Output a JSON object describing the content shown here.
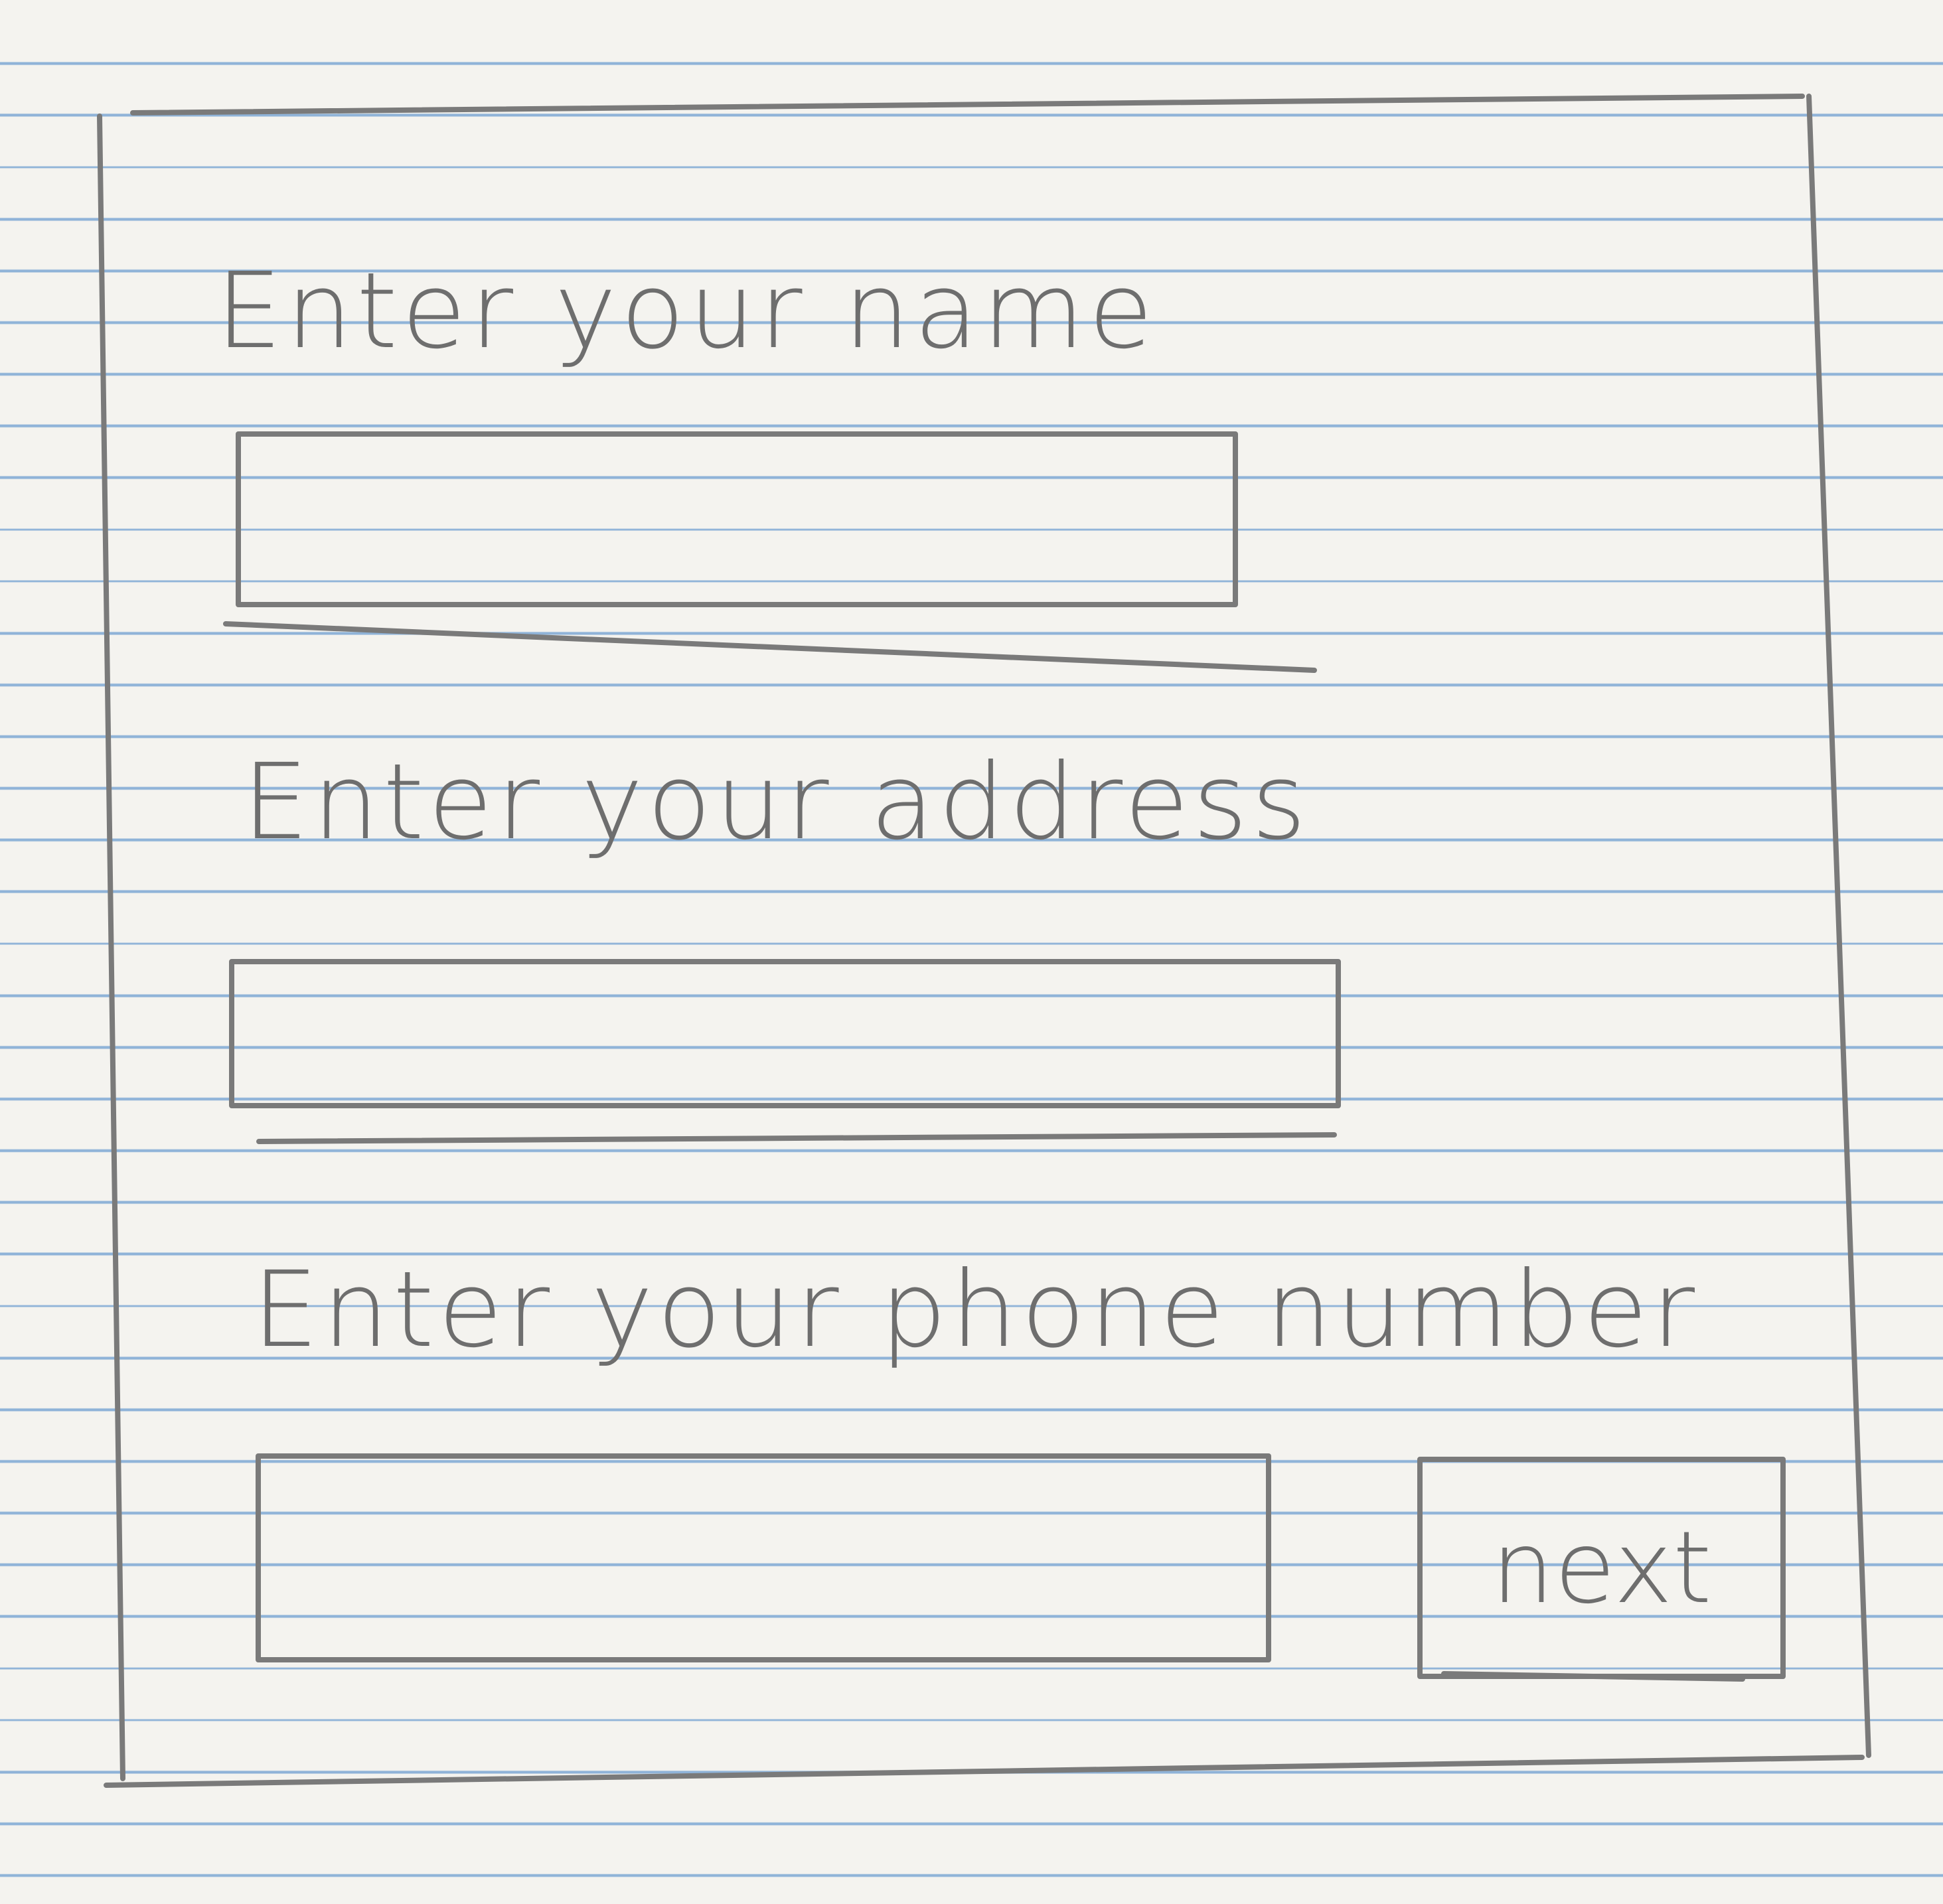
{
  "form": {
    "fields": [
      {
        "label": "Enter your name",
        "value": ""
      },
      {
        "label": "Enter your address",
        "value": ""
      },
      {
        "label": "Enter your phone number",
        "value": ""
      }
    ],
    "next_label": "next"
  }
}
